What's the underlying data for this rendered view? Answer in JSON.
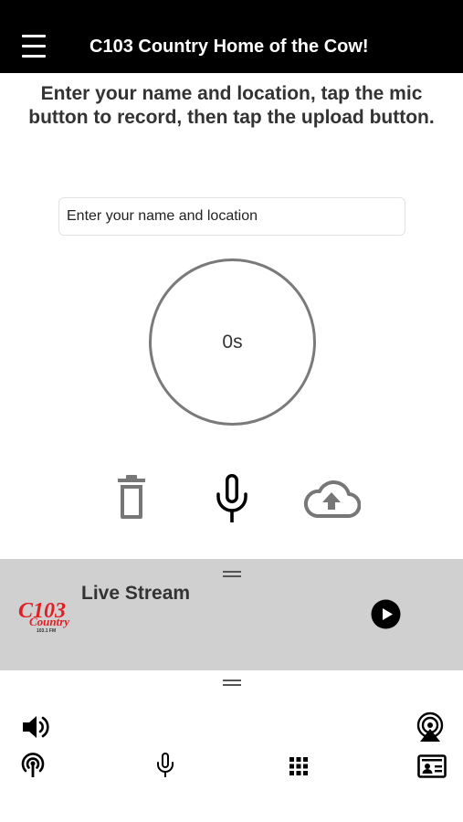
{
  "header": {
    "title": "C103 Country Home of the Cow!"
  },
  "instructions": "Enter your name and location, tap the mic button to record, then tap the upload button.",
  "name_input": {
    "placeholder": "Enter your name and location",
    "value": ""
  },
  "timer": {
    "label": "0s"
  },
  "controls": {
    "delete_icon": "trash-icon",
    "record_icon": "microphone-icon",
    "upload_icon": "cloud-upload-icon"
  },
  "player": {
    "stream_title": "Live Stream",
    "logo": {
      "main": "C103",
      "sub": "Country",
      "freq": "103.1 FM"
    },
    "colors": {
      "background": "#d0d0d0",
      "logo_red": "#e01e24"
    }
  },
  "bottom_bar": {
    "icons": [
      "volume-icon",
      "airplay-icon",
      "podcast-icon",
      "microphone-icon",
      "grid-icon",
      "contact-card-icon"
    ]
  },
  "colors": {
    "header_bg": "#000000",
    "header_text": "#ffffff"
  }
}
